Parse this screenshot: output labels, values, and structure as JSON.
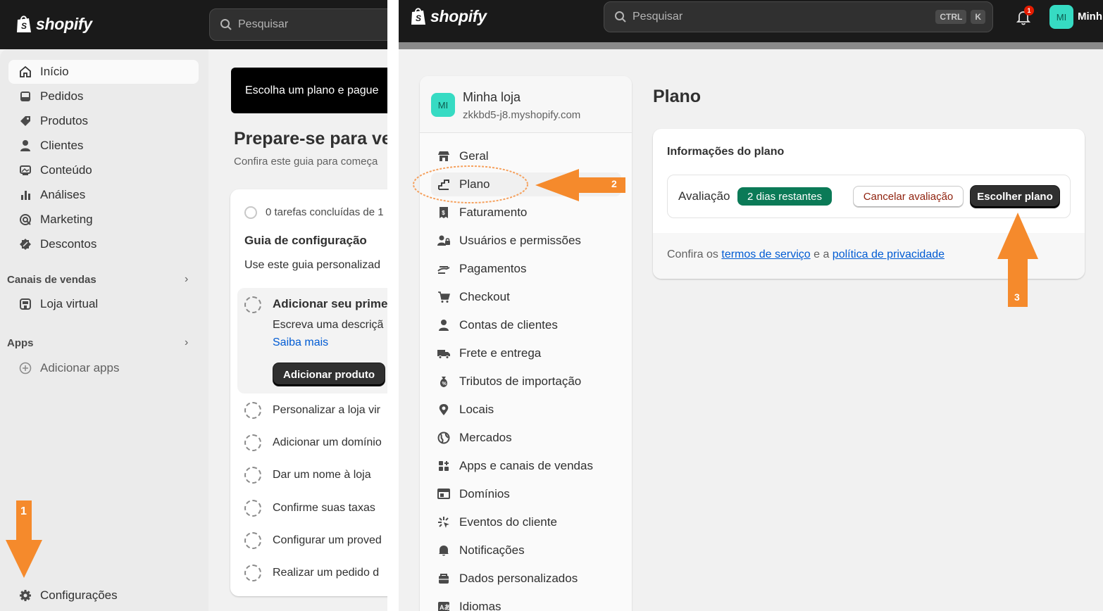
{
  "brand": "shopify",
  "search": {
    "placeholder": "Pesquisar",
    "kbd_ctrl": "CTRL",
    "kbd_k": "K"
  },
  "sidebar": {
    "items": [
      {
        "label": "Início",
        "icon": "home-icon",
        "active": true
      },
      {
        "label": "Pedidos",
        "icon": "inbox-icon"
      },
      {
        "label": "Produtos",
        "icon": "tag-icon"
      },
      {
        "label": "Clientes",
        "icon": "person-icon"
      },
      {
        "label": "Conteúdo",
        "icon": "image-icon"
      },
      {
        "label": "Análises",
        "icon": "chart-bars-icon"
      },
      {
        "label": "Marketing",
        "icon": "target-icon"
      },
      {
        "label": "Descontos",
        "icon": "discount-icon"
      }
    ],
    "sales_channels": {
      "label": "Canais de vendas",
      "items": [
        {
          "label": "Loja virtual",
          "icon": "store-icon"
        }
      ]
    },
    "apps": {
      "label": "Apps",
      "add_label": "Adicionar apps"
    },
    "settings_label": "Configurações"
  },
  "home": {
    "banner": "Escolha um plano e pague",
    "title": "Prepare-se para ve",
    "subtitle": "Confira este guia para começa",
    "tasks_count": "0 tarefas concluídas de 1",
    "guide_title": "Guia de configuração",
    "guide_desc": "Use este guia personalizad",
    "expanded": {
      "title": "Adicionar seu primeir",
      "desc": "Escreva uma descriçã",
      "link": "Saiba mais",
      "button": "Adicionar produto"
    },
    "tasks": [
      "Personalizar a loja vir",
      "Adicionar um domínio",
      "Dar um nome à loja",
      "Confirme suas taxas",
      "Configurar um proved",
      "Realizar um pedido d"
    ]
  },
  "header_right": {
    "notifications": "1",
    "avatar": "MI",
    "store_short": "Minh"
  },
  "settings": {
    "store_name": "Minha loja",
    "store_url": "zkkbd5-j8.myshopify.com",
    "items": [
      {
        "label": "Geral",
        "icon": "store-icon"
      },
      {
        "label": "Plano",
        "icon": "plan-icon",
        "active": true
      },
      {
        "label": "Faturamento",
        "icon": "receipt-icon"
      },
      {
        "label": "Usuários e permissões",
        "icon": "users-icon"
      },
      {
        "label": "Pagamentos",
        "icon": "payment-icon"
      },
      {
        "label": "Checkout",
        "icon": "cart-icon"
      },
      {
        "label": "Contas de clientes",
        "icon": "person-icon"
      },
      {
        "label": "Frete e entrega",
        "icon": "truck-icon"
      },
      {
        "label": "Tributos de importação",
        "icon": "money-bag-icon"
      },
      {
        "label": "Locais",
        "icon": "location-icon"
      },
      {
        "label": "Mercados",
        "icon": "globe-icon"
      },
      {
        "label": "Apps e canais de vendas",
        "icon": "apps-icon"
      },
      {
        "label": "Domínios",
        "icon": "domain-icon"
      },
      {
        "label": "Eventos do cliente",
        "icon": "sparkle-icon"
      },
      {
        "label": "Notificações",
        "icon": "bell-icon"
      },
      {
        "label": "Dados personalizados",
        "icon": "database-icon"
      },
      {
        "label": "Idiomas",
        "icon": "language-icon"
      }
    ]
  },
  "plan": {
    "title": "Plano",
    "card_title": "Informações do plano",
    "trial_label": "Avaliação",
    "days_left": "2 dias restantes",
    "cancel_button": "Cancelar avaliação",
    "choose_button": "Escolher plano",
    "footer_prefix": "Confira os",
    "terms_link": "termos de serviço",
    "footer_mid": "e a",
    "privacy_link": "política de privacidade"
  },
  "steps": {
    "one": "1",
    "two": "2",
    "three": "3"
  },
  "colors": {
    "accent_arrow": "#f58a2c",
    "badge_green": "#0b7a57",
    "avatar_teal": "#36dbc3"
  }
}
